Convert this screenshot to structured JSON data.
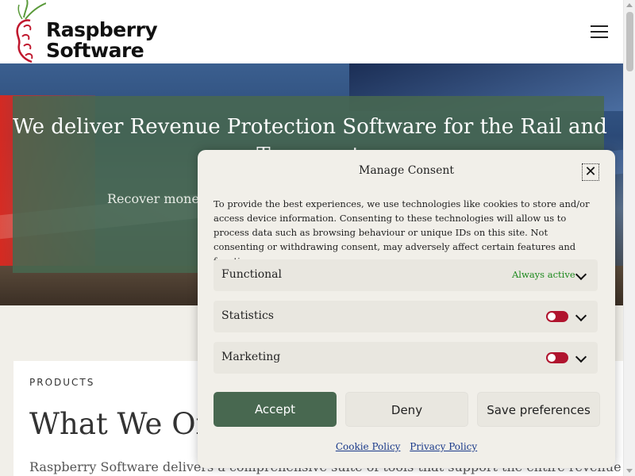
{
  "header": {
    "logo_line1": "Raspberry",
    "logo_line2": "Software",
    "menu_icon": "hamburger-menu-icon"
  },
  "hero": {
    "title_line1": "We deliver Revenue Protection Software for the Rail and",
    "title_line2": "Transport",
    "subtitle": "Recover money"
  },
  "products": {
    "label": "PRODUCTS",
    "heading": "What We Offer",
    "description": "Raspberry Software delivers a comprehensive suite of tools that support the entire revenue"
  },
  "consent": {
    "title": "Manage Consent",
    "close_icon": "close-icon",
    "text": "To provide the best experiences, we use technologies like cookies to store and/or access device information. Consenting to these technologies will allow us to process data such as browsing behaviour or unique IDs on this site. Not consenting or withdrawing consent, may adversely affect certain features and functions.",
    "categories": [
      {
        "label": "Functional",
        "status": "Always active"
      },
      {
        "label": "Statistics"
      },
      {
        "label": "Marketing"
      }
    ],
    "buttons": {
      "accept": "Accept",
      "deny": "Deny",
      "save": "Save preferences"
    },
    "links": {
      "cookie_policy": "Cookie Policy",
      "privacy_policy": "Privacy Policy"
    }
  },
  "colors": {
    "brand_green": "#486850",
    "toggle_off": "#b0142e",
    "always_active": "#1e8a1e"
  }
}
